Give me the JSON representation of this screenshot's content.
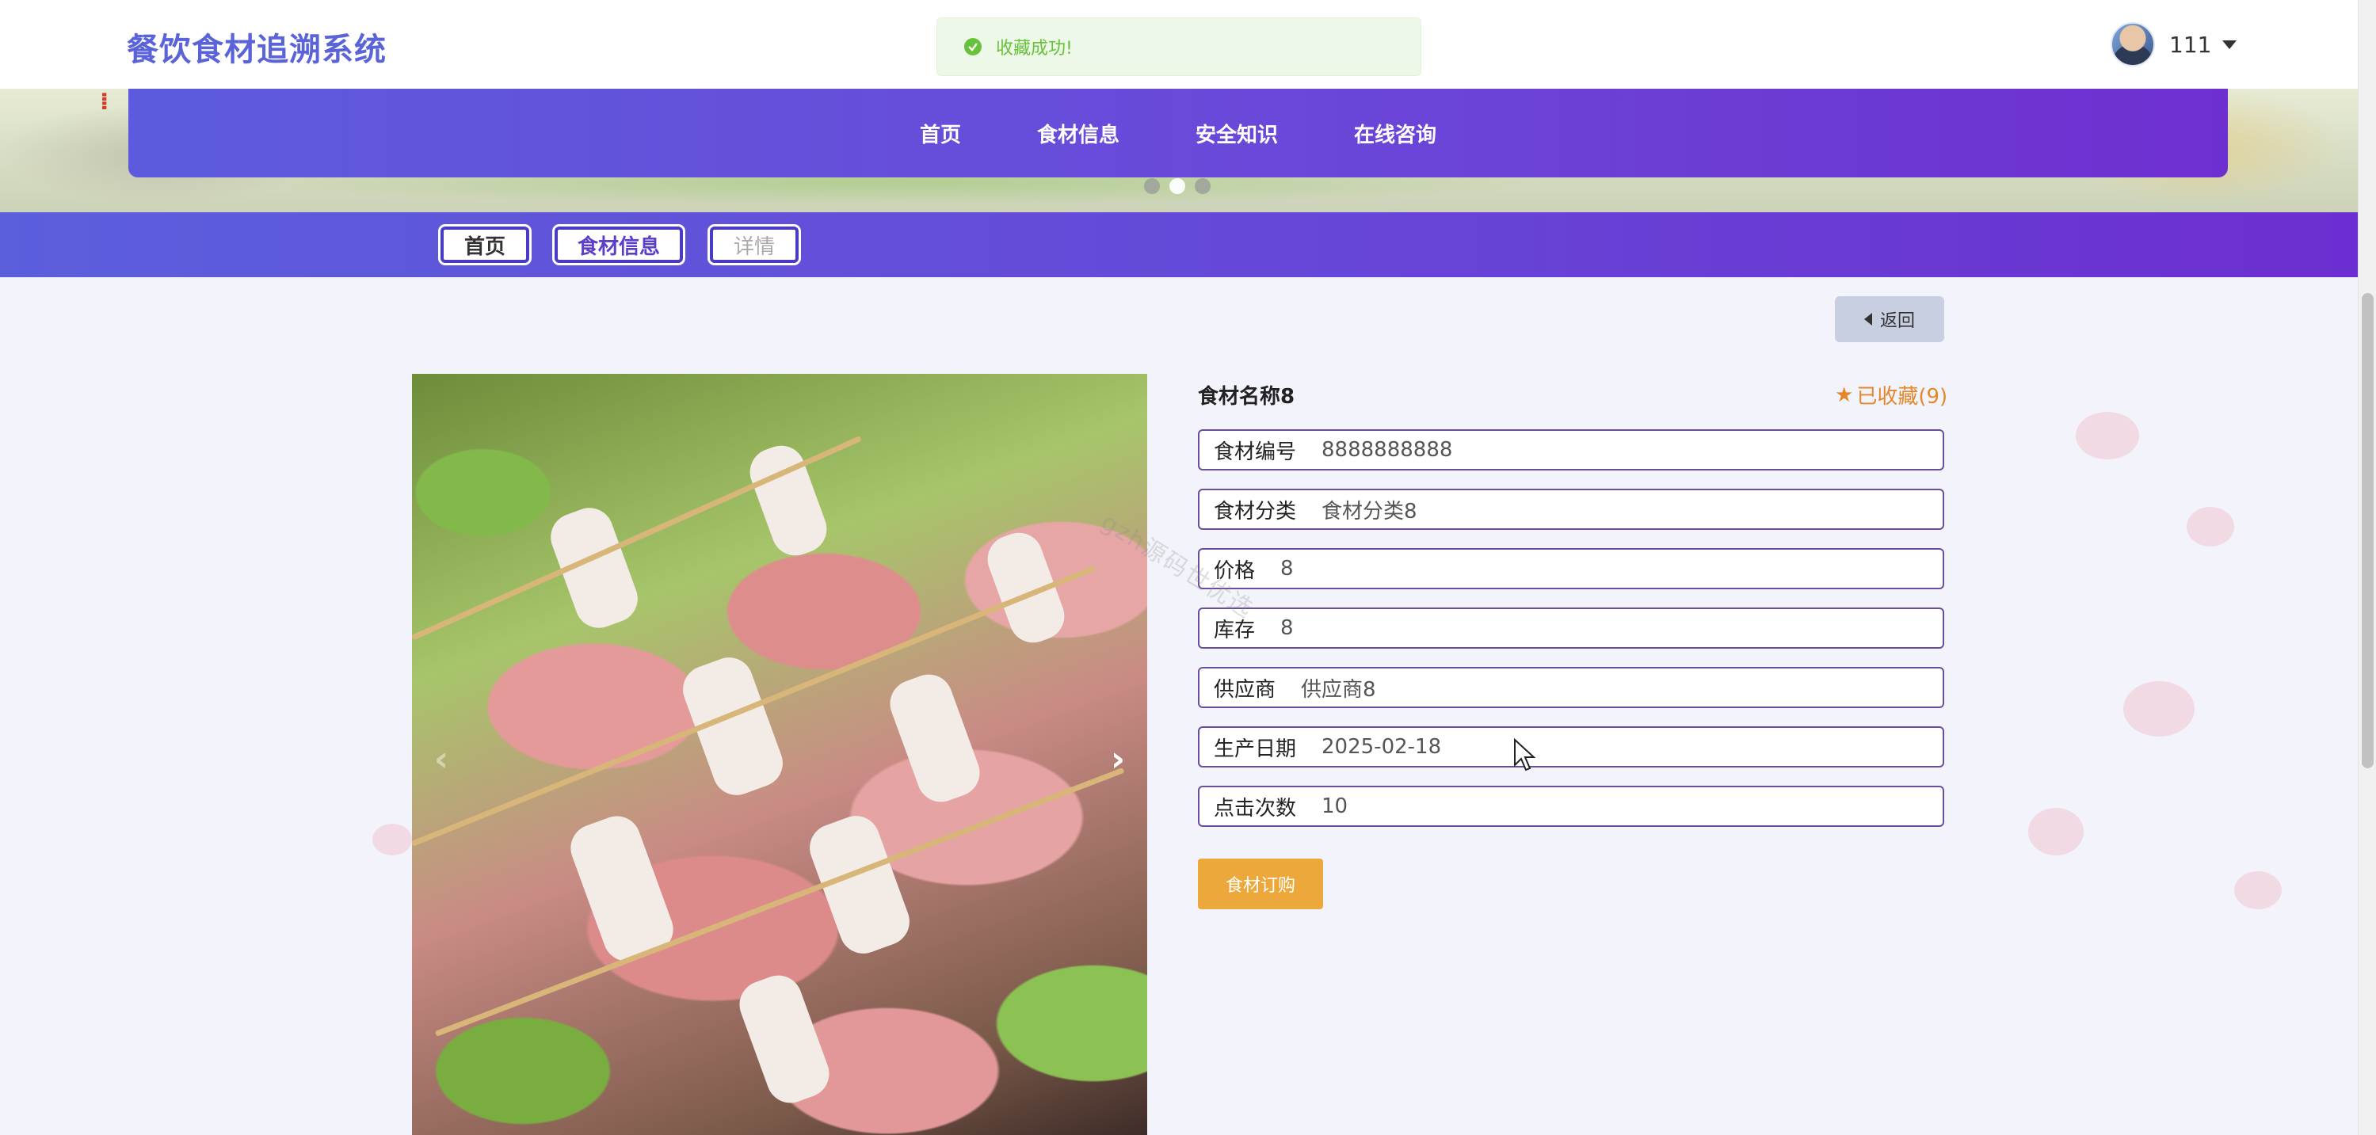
{
  "app": {
    "title": "餐饮食材追溯系统",
    "toast": "收藏成功!"
  },
  "user": {
    "name": "111"
  },
  "nav": {
    "items": [
      {
        "label": "首页"
      },
      {
        "label": "食材信息"
      },
      {
        "label": "安全知识"
      },
      {
        "label": "在线咨询"
      }
    ]
  },
  "breadcrumb": {
    "items": [
      {
        "label": "首页"
      },
      {
        "label": "食材信息"
      },
      {
        "label": "详情"
      }
    ]
  },
  "actions": {
    "back_label": "返回",
    "order_label": "食材订购"
  },
  "detail": {
    "title": "食材名称8",
    "favorite_label": "已收藏(9)",
    "fields": [
      {
        "label": "食材编号",
        "value": "8888888888"
      },
      {
        "label": "食材分类",
        "value": "食材分类8"
      },
      {
        "label": "价格",
        "value": "8"
      },
      {
        "label": "库存",
        "value": "8"
      },
      {
        "label": "供应商",
        "value": "供应商8"
      },
      {
        "label": "生产日期",
        "value": "2025-02-18"
      },
      {
        "label": "点击次数",
        "value": "10"
      }
    ]
  },
  "carousel": {
    "active_index": 1
  },
  "watermark": "gzh源码世优选",
  "colors": {
    "brand": "#5b63d9",
    "nav_gradient_start": "#5d5bdc",
    "nav_gradient_end": "#6e2fd0",
    "favorite": "#e6862a",
    "order_button": "#eda83b",
    "toast_success": "#67c23a"
  },
  "icons": {
    "toast": "check-circle-icon",
    "favorite": "star-icon",
    "back": "caret-left-icon",
    "user_menu": "caret-down-icon",
    "prev": "chevron-left-icon",
    "next": "chevron-right-icon"
  }
}
